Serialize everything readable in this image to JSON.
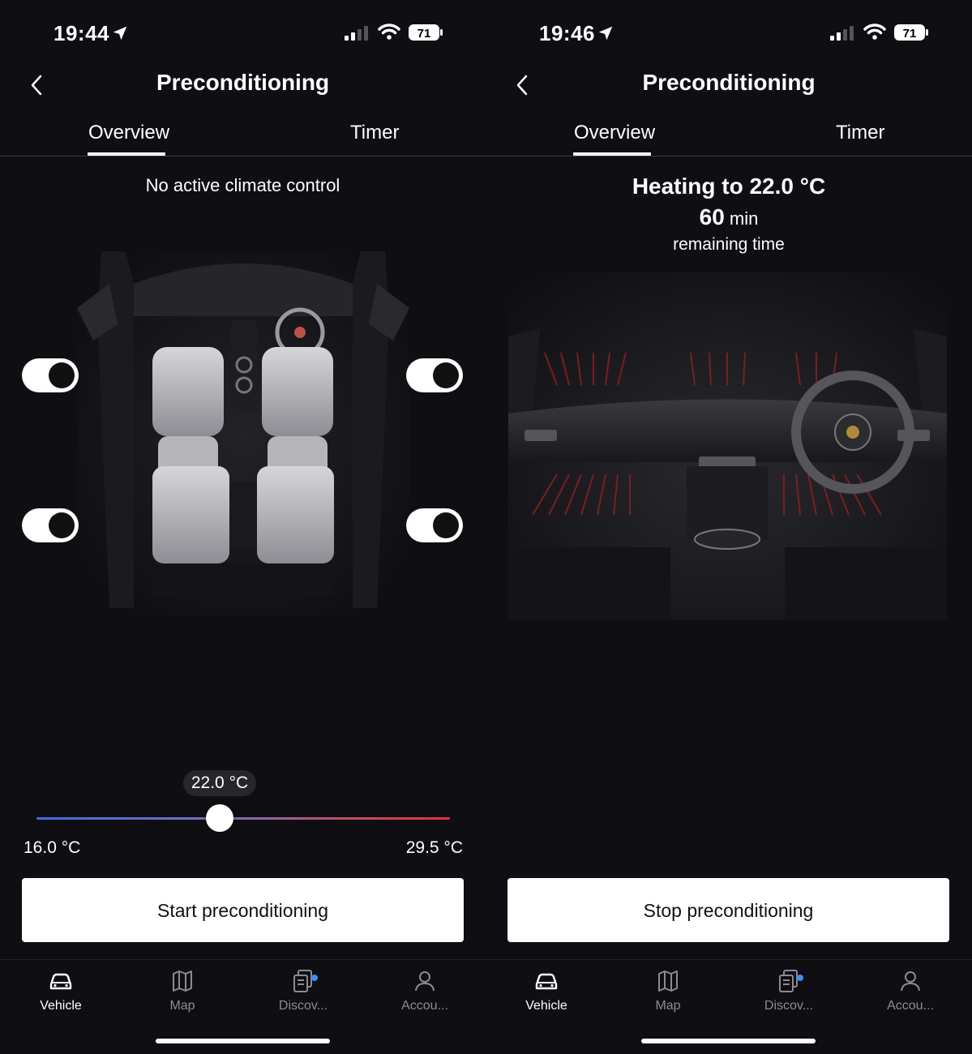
{
  "screens": [
    {
      "status_bar": {
        "time": "19:44",
        "battery": "71"
      },
      "header": {
        "title": "Preconditioning"
      },
      "tabs": [
        {
          "label": "Overview",
          "selected": true
        },
        {
          "label": "Timer",
          "selected": false
        }
      ],
      "status_text": "No active climate control",
      "seat_toggles": [
        {
          "seat": "front-left",
          "on": true
        },
        {
          "seat": "front-right",
          "on": true
        },
        {
          "seat": "rear-left",
          "on": true
        },
        {
          "seat": "rear-right",
          "on": true
        }
      ],
      "temperature": {
        "value": "22.0 °C",
        "min": "16.0 °C",
        "max": "29.5 °C",
        "fraction": 0.44
      },
      "primary_button": "Start preconditioning",
      "nav": [
        {
          "label": "Vehicle",
          "icon": "car-icon",
          "active": true
        },
        {
          "label": "Map",
          "icon": "map-icon",
          "active": false
        },
        {
          "label": "Discov...",
          "icon": "discover-icon",
          "active": false,
          "badge": true
        },
        {
          "label": "Accou...",
          "icon": "account-icon",
          "active": false
        }
      ]
    },
    {
      "status_bar": {
        "time": "19:46",
        "battery": "71"
      },
      "header": {
        "title": "Preconditioning"
      },
      "tabs": [
        {
          "label": "Overview",
          "selected": true
        },
        {
          "label": "Timer",
          "selected": false
        }
      ],
      "heating": {
        "title": "Heating to 22.0 °C",
        "minutes": "60",
        "unit": "min",
        "subtitle": "remaining time"
      },
      "primary_button": "Stop preconditioning",
      "nav": [
        {
          "label": "Vehicle",
          "icon": "car-icon",
          "active": true
        },
        {
          "label": "Map",
          "icon": "map-icon",
          "active": false
        },
        {
          "label": "Discov...",
          "icon": "discover-icon",
          "active": false,
          "badge": true
        },
        {
          "label": "Accou...",
          "icon": "account-icon",
          "active": false
        }
      ]
    }
  ],
  "colors": {
    "background": "#0f0f13",
    "accent_blue": "#3e6ee0",
    "accent_red": "#e0323e",
    "badge": "#3d8dff"
  }
}
